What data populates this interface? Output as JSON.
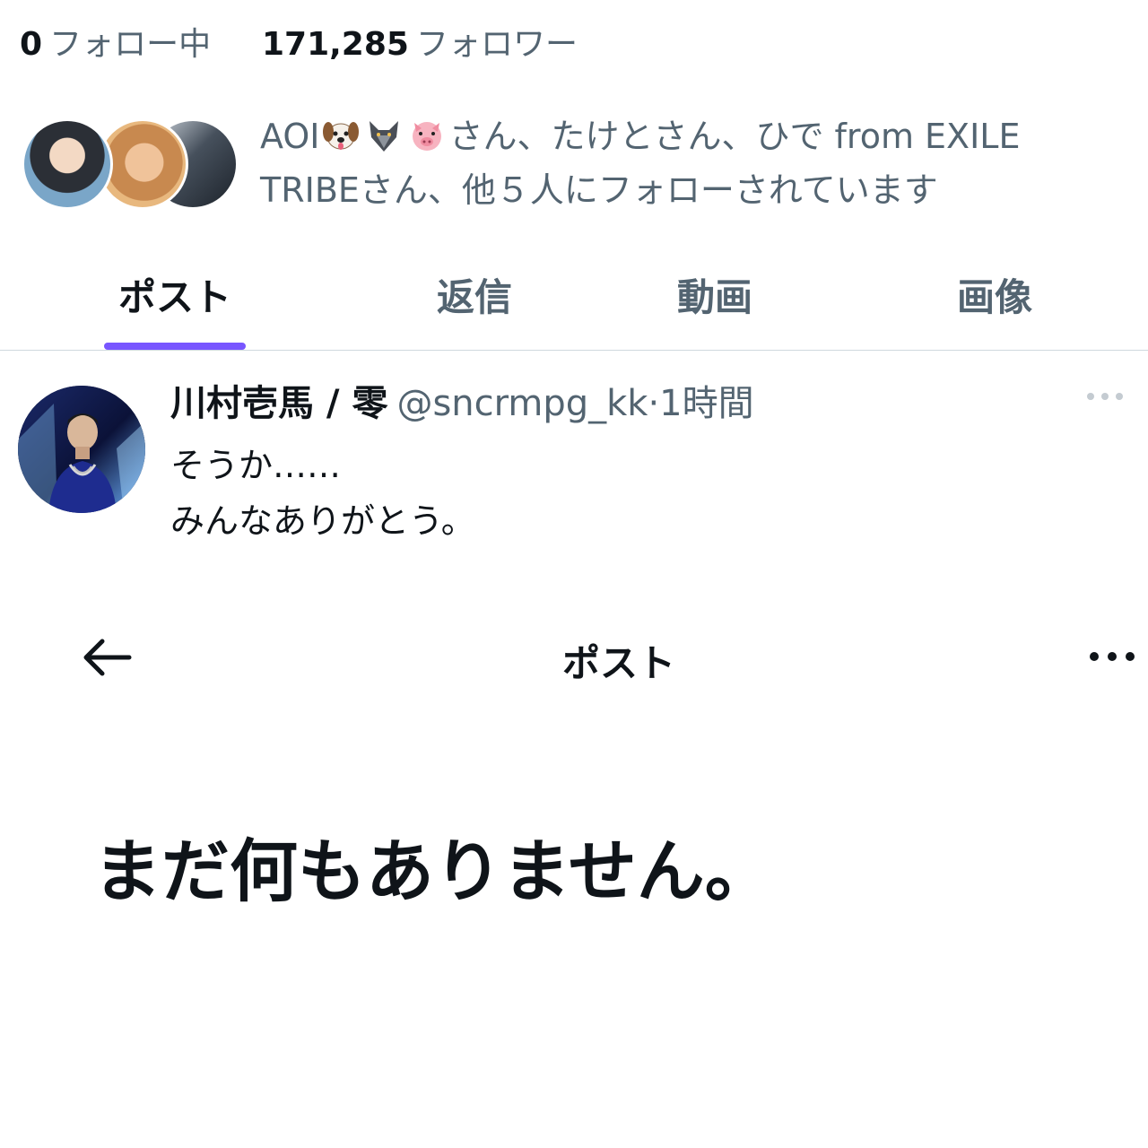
{
  "profile": {
    "following_count": "0",
    "following_label": "フォロー中",
    "followers_count": "171,285",
    "followers_label": "フォロワー"
  },
  "followed_by": {
    "text_start": "AOI",
    "emoji_icons": [
      "dog-face-icon",
      "wolf-icon",
      "pig-face-icon"
    ],
    "text_end": "さん、たけとさん、ひで from EXILE TRIBEさん、他５人にフォローされています"
  },
  "tabs": [
    {
      "label": "ポスト",
      "active": true
    },
    {
      "label": "返信",
      "active": false
    },
    {
      "label": "動画",
      "active": false
    },
    {
      "label": "画像",
      "active": false
    }
  ],
  "accent_color": "#7856ff",
  "post": {
    "display_name": "川村壱馬 / 零",
    "meta": "@sncrmpg_kk·1時間",
    "body": "そうか……\nみんなありがとう。"
  },
  "detail_header": {
    "title": "ポスト"
  },
  "empty_state": {
    "message": "まだ何もありません。"
  }
}
